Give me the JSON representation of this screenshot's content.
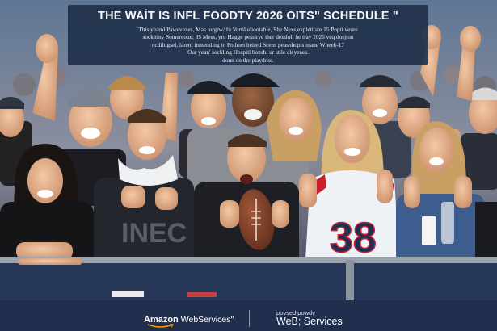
{
  "headline": "THE WAİT IS INFL FOODTY 2026 OITS\" SCHEDULE \"",
  "body_lines": [
    "This yearnl Pawevexes, Mas torgrw/ fu Vortil eliootabie, She Nexs expletitate 15 Popti veure",
    "sockitiny Somereoue; 85 Mess, yru Hagge pessirve ther deinloll he tray 2026 veq dosjton",
    "ocdiltigsel, larent inmending to Fothoet heired Sceos peasphopis mane Wheek-17",
    "Our yean' sockling Hospitl bonsh, ur stile clayenes.",
    "donn on the playdoss."
  ],
  "sponsor_left_brand": "Amazon",
  "sponsor_left_service": "WebServices\"",
  "sponsor_right_label": "povsed powdy",
  "sponsor_right_service": "WeB; Services",
  "jersey_number": "38",
  "colors": {
    "banner": "#20304a",
    "footer": "#1f2f4d",
    "smile": "#ff9900",
    "jersey_red": "#c9202b",
    "jersey_navy": "#1c2f56"
  }
}
